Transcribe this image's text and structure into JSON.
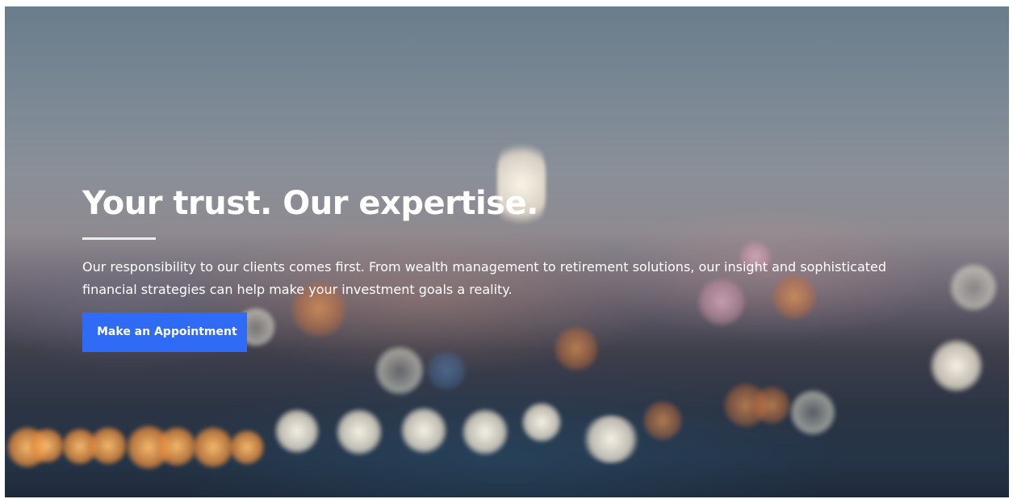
{
  "hero": {
    "headline": "Your trust. Our expertise.",
    "intro": "Our responsibility to our clients comes first. From wealth management to retirement solutions, our insight and sophisticated financial strategies can help make your investment goals a reality.",
    "cta_label": "Make an Appointment",
    "cta_color": "#2f6bf5",
    "text_color": "#ffffff"
  }
}
